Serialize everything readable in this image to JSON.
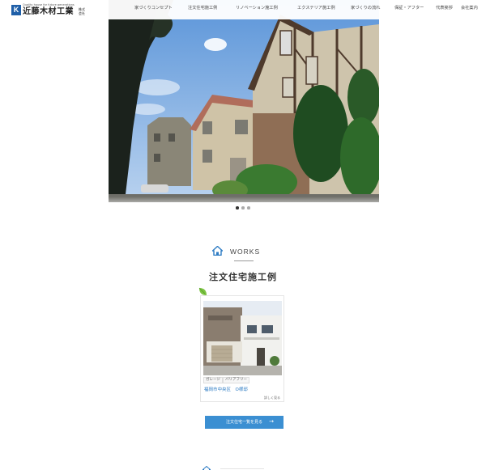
{
  "logo": {
    "mark": "K",
    "tagline": "Quality house for future generations",
    "name": "近藤木材工業",
    "suffix": "株式会社"
  },
  "nav": {
    "items": [
      "家づくりコンセプト",
      "注文住宅施工例",
      "リノベーション施工例",
      "エクステリア施工例",
      "家づくりの流れ",
      "保証・アフター",
      "代表挨拶",
      "会社案内"
    ]
  },
  "slider": {
    "count": 3,
    "active": 0
  },
  "works": {
    "label": "WORKS",
    "title": "注文住宅施工例",
    "card": {
      "tags": [
        "ガレージ",
        "バリアフリー"
      ],
      "place": "福岡市中央区　O様邸",
      "more": "詳しく見る"
    },
    "button_label": "注文住宅一覧を見る",
    "button_arrow": "→"
  },
  "colors": {
    "accent": "#3b8fd2",
    "link": "#2e7cc4",
    "logo": "#1f5fa8",
    "leaf": "#7cc242"
  }
}
